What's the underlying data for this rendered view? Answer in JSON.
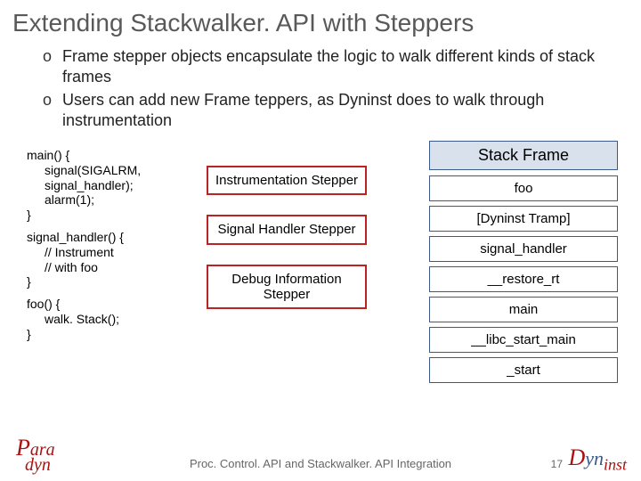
{
  "title": "Extending Stackwalker. API with Steppers",
  "bullets": [
    "Frame stepper objects encapsulate the logic to walk different kinds of stack frames",
    "Users can add new Frame teppers, as Dyninst does to walk through instrumentation"
  ],
  "code": {
    "main": {
      "sig": "main() {",
      "l1": "signal(SIGALRM,",
      "l2": " signal_handler);",
      "l3": "alarm(1);",
      "close": "}"
    },
    "sh": {
      "sig": "signal_handler() {",
      "l1": "// Instrument",
      "l2": "// with foo",
      "close": "}"
    },
    "foo": {
      "sig": "foo() {",
      "l1": "walk. Stack();",
      "close": "}"
    }
  },
  "steppers": [
    "Instrumentation Stepper",
    "Signal Handler Stepper",
    "Debug Information Stepper"
  ],
  "stack": {
    "header": "Stack Frame",
    "cells": [
      "foo",
      "[Dyninst Tramp]",
      "signal_handler",
      "__restore_rt",
      "main",
      "__libc_start_main",
      "_start"
    ]
  },
  "footer": {
    "caption": "Proc. Control. API and Stackwalker. API Integration",
    "page": "17"
  }
}
